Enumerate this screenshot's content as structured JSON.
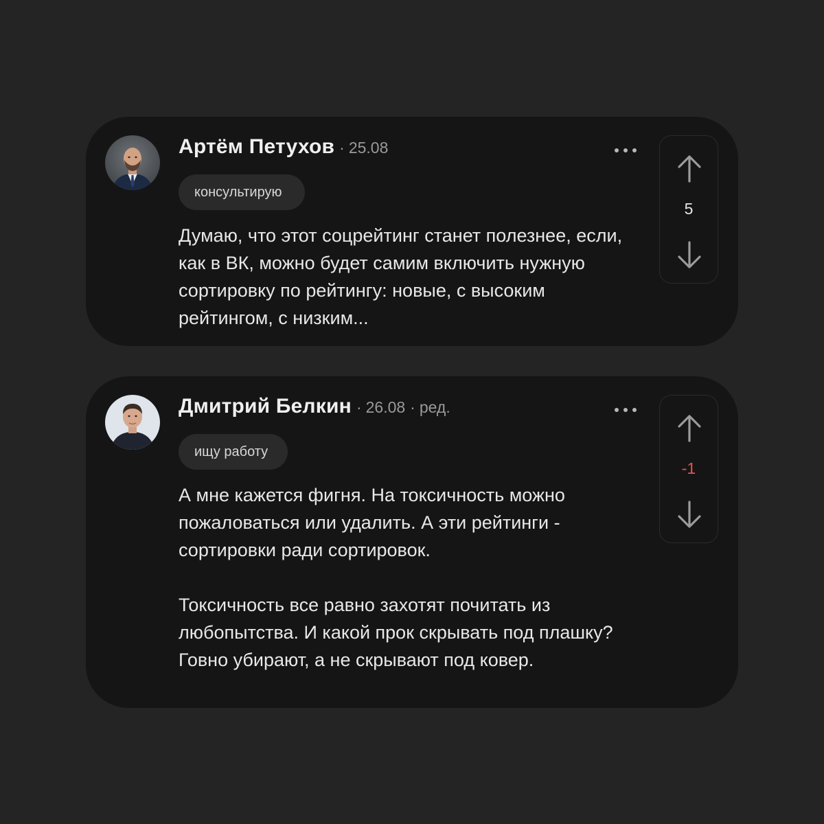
{
  "comments": [
    {
      "author": "Артём Петухов",
      "separator": "·",
      "date": "25.08",
      "edited": "",
      "status_tag": "консультирую",
      "paragraphs": [
        "Думаю, что этот соцрейтинг станет полезнее, если, как в ВК, можно будет самим включить нужную сортировку по рейтингу: новые, с высоким рейтингом, с низким..."
      ],
      "rating": "5",
      "rating_color": "#e6e6e6"
    },
    {
      "author": "Дмитрий Белкин",
      "separator": "·",
      "date": "26.08",
      "edited": "ред.",
      "status_tag": "ищу работу",
      "paragraphs": [
        "А мне кажется фигня. На токсичность можно пожаловаться или удалить. А эти рейтинги - сортировки ради сортировок.",
        "Токсичность все равно захотят почитать из любопытства. И какой прок скрывать под плашку? Говно убирают, а не скрывают под ковер."
      ],
      "rating": "-1",
      "rating_color": "#e5534b"
    }
  ],
  "icons": {
    "more": "more-horizontal-icon",
    "upvote": "arrow-up-icon",
    "downvote": "arrow-down-icon"
  },
  "colors": {
    "background": "#242424",
    "card": "#151515",
    "tag_background": "#2a2a2a",
    "meta_text": "#9a9a9a",
    "negative_rating": "#e5534b"
  }
}
